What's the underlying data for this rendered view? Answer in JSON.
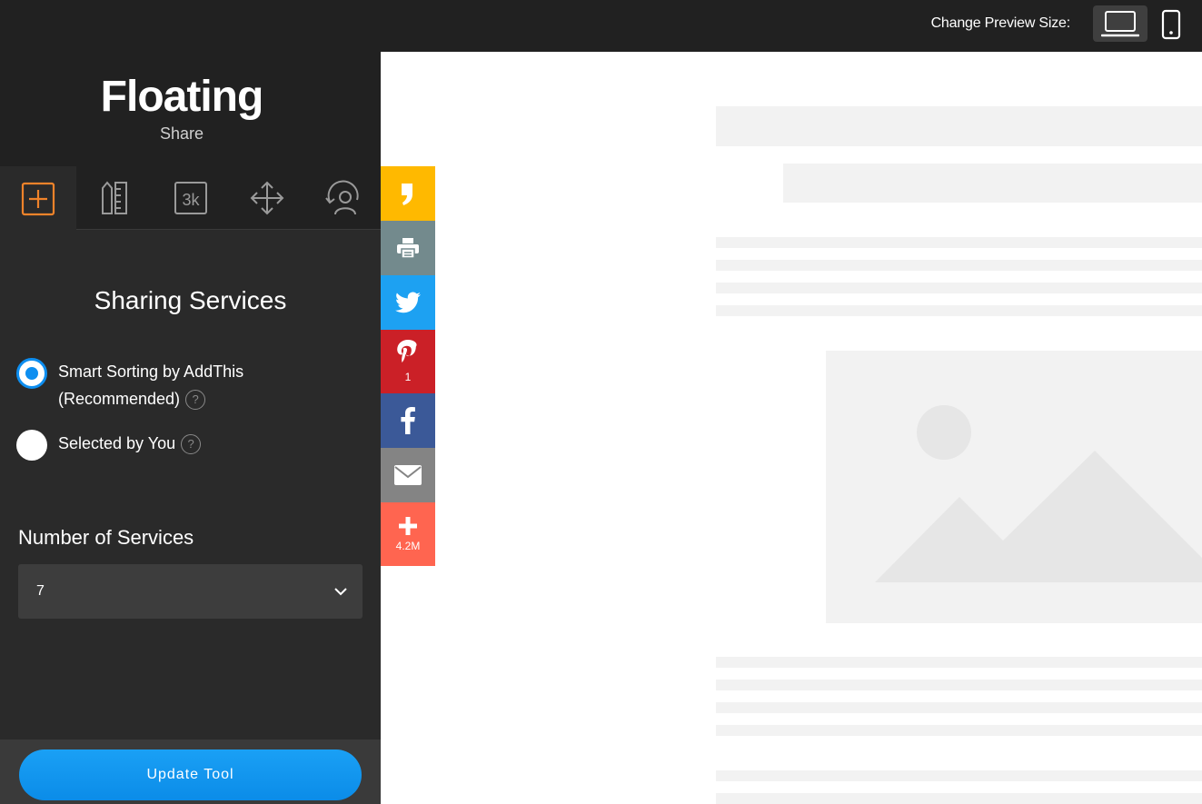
{
  "topbar": {
    "preview_label": "Change Preview Size:",
    "desktop_icon": "laptop-icon",
    "mobile_icon": "phone-icon"
  },
  "tool": {
    "title": "Floating",
    "subtitle": "Share"
  },
  "tabs": [
    {
      "icon": "add-square-icon",
      "active": true
    },
    {
      "icon": "ruler-pencil-icon",
      "active": false
    },
    {
      "icon": "counter-3k-icon",
      "active": false,
      "glyph": "3k"
    },
    {
      "icon": "move-arrows-icon",
      "active": false
    },
    {
      "icon": "user-target-icon",
      "active": false
    }
  ],
  "sharing": {
    "title": "Sharing Services",
    "options": [
      {
        "label_line1": "Smart Sorting by AddThis",
        "label_line2": "(Recommended)",
        "checked": true
      },
      {
        "label_line1": "Selected by You",
        "checked": false
      }
    ],
    "help_glyph": "?"
  },
  "services": {
    "label": "Number of Services",
    "selected": "7"
  },
  "footer": {
    "update_label": "Update Tool"
  },
  "share_bar": [
    {
      "service": "quote",
      "icon": "quote-icon",
      "color": "#ffb900",
      "count": ""
    },
    {
      "service": "print",
      "icon": "print-icon",
      "color": "#738a8d",
      "count": ""
    },
    {
      "service": "twitter",
      "icon": "twitter-icon",
      "color": "#1da1f2",
      "count": ""
    },
    {
      "service": "pinterest",
      "icon": "pinterest-icon",
      "color": "#cb2027",
      "count": "1"
    },
    {
      "service": "facebook",
      "icon": "facebook-icon",
      "color": "#3b5998",
      "count": ""
    },
    {
      "service": "email",
      "icon": "email-icon",
      "color": "#848484",
      "count": ""
    },
    {
      "service": "more",
      "icon": "plus-icon",
      "color": "#ff6550",
      "count": "4.2M"
    }
  ],
  "colors": {
    "accent": "#0d8ef0",
    "active_tab_icon": "#f0832a"
  }
}
